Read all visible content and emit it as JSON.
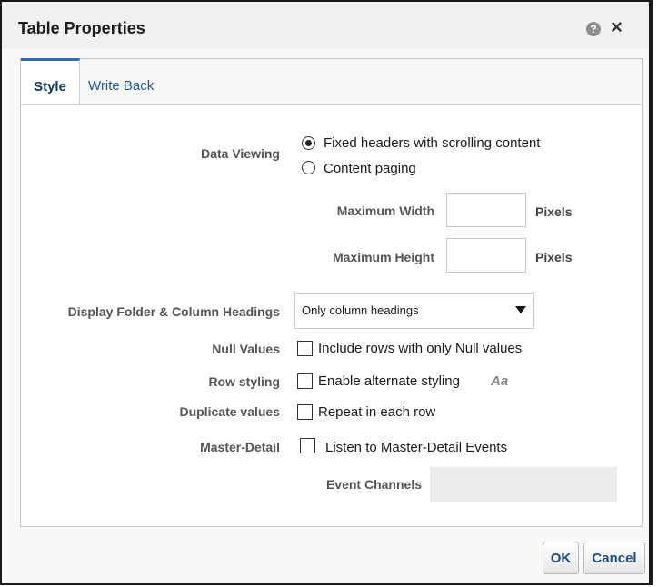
{
  "dialog": {
    "title": "Table Properties",
    "help_icon": "?",
    "close_icon": "×"
  },
  "tabs": [
    {
      "label": "Style",
      "active": true
    },
    {
      "label": "Write Back",
      "active": false
    }
  ],
  "data_viewing": {
    "label": "Data Viewing",
    "options": [
      {
        "label": "Fixed headers with scrolling content",
        "selected": true
      },
      {
        "label": "Content paging",
        "selected": false
      }
    ],
    "max_width": {
      "label": "Maximum Width",
      "value": "",
      "unit": "Pixels"
    },
    "max_height": {
      "label": "Maximum Height",
      "value": "",
      "unit": "Pixels"
    }
  },
  "display_headings": {
    "label": "Display Folder & Column Headings",
    "value": "Only column headings"
  },
  "null_values": {
    "label": "Null Values",
    "option": "Include rows with only Null values",
    "checked": false
  },
  "row_styling": {
    "label": "Row styling",
    "option": "Enable alternate styling",
    "checked": false,
    "format_icon": "Aa"
  },
  "duplicate_values": {
    "label": "Duplicate values",
    "option": "Repeat in each row",
    "checked": false
  },
  "master_detail": {
    "label": "Master-Detail",
    "option": "Listen to Master-Detail Events",
    "checked": false
  },
  "event_channels": {
    "label": "Event Channels",
    "value": ""
  },
  "buttons": {
    "ok": "OK",
    "cancel": "Cancel"
  }
}
